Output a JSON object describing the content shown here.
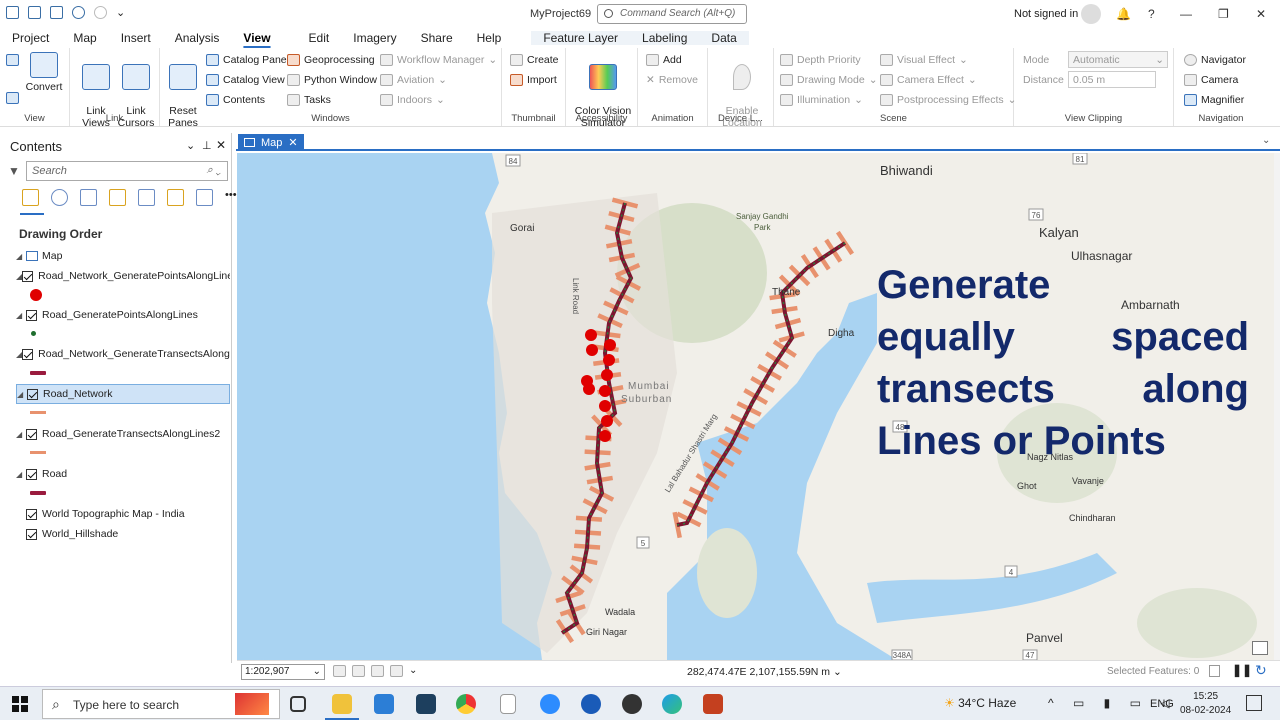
{
  "app": {
    "title": "MyProject69",
    "command_search_placeholder": "Command Search (Alt+Q)",
    "signin": "Not signed in"
  },
  "tabs": [
    "Project",
    "Map",
    "Insert",
    "Analysis",
    "View",
    "Edit",
    "Imagery",
    "Share",
    "Help",
    "Feature Layer",
    "Labeling",
    "Data"
  ],
  "ribbon": {
    "view_group": {
      "convert": "Convert",
      "label": "View"
    },
    "link_group": {
      "link_views": "Link\nViews",
      "link_cursors": "Link\nCursors",
      "label": "Link"
    },
    "windows_group": {
      "reset_panes": "Reset\nPanes",
      "catalog_pane": "Catalog Pane",
      "catalog_view": "Catalog View",
      "contents": "Contents",
      "geoprocessing": "Geoprocessing",
      "python_window": "Python Window",
      "tasks": "Tasks",
      "workflow_manager": "Workflow Manager",
      "aviation": "Aviation",
      "indoors": "Indoors",
      "label": "Windows"
    },
    "thumbnail_group": {
      "create": "Create",
      "import": "Import",
      "label": "Thumbnail"
    },
    "accessibility_group": {
      "color_vision": "Color Vision\nSimulator",
      "label": "Accessibility"
    },
    "animation_group": {
      "add": "Add",
      "remove": "Remove",
      "label": "Animation"
    },
    "device_group": {
      "enable_location": "Enable\nLocation",
      "label": "Device L..."
    },
    "scene_group": {
      "depth_priority": "Depth Priority",
      "drawing_mode": "Drawing Mode",
      "illumination": "Illumination",
      "visual_effect": "Visual Effect",
      "camera_effect": "Camera Effect",
      "postprocessing": "Postprocessing Effects",
      "label": "Scene"
    },
    "clipping_group": {
      "mode_label": "Mode",
      "mode_value": "Automatic",
      "distance_label": "Distance",
      "distance_value": "0.05  m",
      "label": "View Clipping"
    },
    "navigation_group": {
      "navigator": "Navigator",
      "camera": "Camera",
      "magnifier": "Magnifier",
      "label": "Navigation"
    }
  },
  "contents": {
    "title": "Contents",
    "search_placeholder": "Search",
    "drawing_order": "Drawing Order",
    "layers": [
      {
        "name": "Map"
      },
      {
        "name": "Road_Network_GeneratePointsAlongLines"
      },
      {
        "name": "Road_GeneratePointsAlongLines"
      },
      {
        "name": "Road_Network_GenerateTransectsAlong..."
      },
      {
        "name": "Road_Network"
      },
      {
        "name": "Road_GenerateTransectsAlongLines2"
      },
      {
        "name": "Road"
      },
      {
        "name": "World Topographic Map - India"
      },
      {
        "name": "World_Hillshade"
      }
    ]
  },
  "map": {
    "tab_label": "Map",
    "overlay_lines": [
      "Generate",
      "equally   spaced",
      "transects  along",
      "Lines or Points"
    ],
    "place_labels": {
      "bhiwandi": "Bhiwandi",
      "kalyan": "Kalyan",
      "ulhasnagar": "Ulhasnagar",
      "ambarnath": "Ambarnath",
      "gorai": "Gorai",
      "sgnp": "Sanjay Gandhi\nPark",
      "thane": "Thane",
      "digha": "Digha",
      "mumbai": "Mumbai\nSuburban",
      "link_road": "Link Road",
      "lbs_marg": "Lal Bahadur Shastri Marg",
      "nagz": "Nagz Nitlas",
      "ghot": "Ghot",
      "vavanje": "Vavanje",
      "chindharan": "Chindharan",
      "wadala": "Wadala",
      "giri_nagar": "Giri Nagar",
      "panvel": "Panvel",
      "r84": "84",
      "r81": "81",
      "r76": "76",
      "r5": "5",
      "r4": "4",
      "r48": "48",
      "r348a": "348A",
      "r47": "47"
    }
  },
  "status": {
    "scale": "1:202,907",
    "coordinates": "282,474.47E 2,107,155.59N m",
    "selected_features": "Selected Features: 0"
  },
  "taskbar": {
    "search_placeholder": "Type here to search",
    "weather": "34°C  Haze",
    "lang": "ENG",
    "time": "15:25",
    "date": "08-02-2024"
  },
  "colors": {
    "accent": "#2a6ec4",
    "transect": "#e8926e",
    "road": "#7d1530",
    "point": "#e00000",
    "overlay_text": "#13296b",
    "water": "#a9d3f2"
  }
}
